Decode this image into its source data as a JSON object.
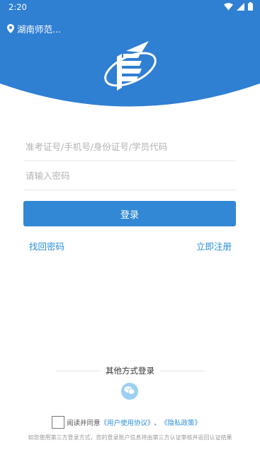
{
  "status_bar": {
    "time": "2:20",
    "icons": [
      "wifi-icon",
      "signal-icon",
      "battery-icon"
    ]
  },
  "header": {
    "location": "湖南师范...",
    "bg_color": "#2f7fd3"
  },
  "form": {
    "account_placeholder": "准考证号/手机号/身份证号/学员代码",
    "password_placeholder": "请输入密码",
    "login_label": "登录",
    "forgot_label": "找回密码",
    "register_label": "立即注册"
  },
  "other_login": {
    "title": "其他方式登录",
    "icons": [
      "wechat-icon"
    ]
  },
  "agreement": {
    "prefix": "阅读并同意",
    "user_agreement": "《用户使用协议》",
    "separator": "、",
    "privacy": "《隐私政策》",
    "notice": "如您使用第三方登录方式，您的登录账户信息将由第三方认证审核并返回认证结果"
  },
  "colors": {
    "primary": "#3288d4",
    "link": "#2a8fd4"
  }
}
